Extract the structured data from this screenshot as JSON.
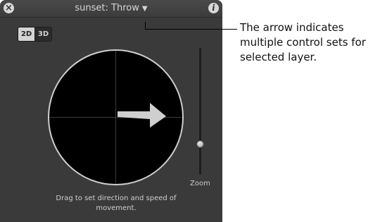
{
  "window": {
    "title": "sunset: Throw",
    "close_icon": "close-icon",
    "info_icon": "info-icon"
  },
  "mode_toggle": {
    "options": [
      "2D",
      "3D"
    ],
    "selected": "2D"
  },
  "slider": {
    "label": "Zoom",
    "level": 0.24
  },
  "hint": "Drag to set direction and speed of movement.",
  "callout": {
    "text": "The arrow indicates multiple control sets for selected layer."
  }
}
